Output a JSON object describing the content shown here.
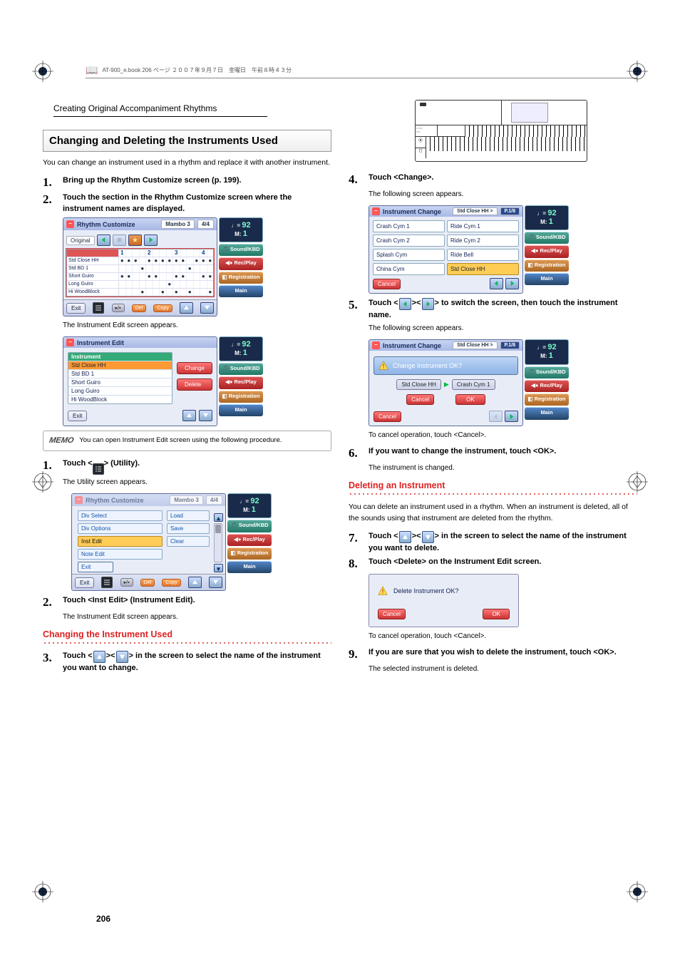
{
  "header_line": "AT-900_e.book  206 ページ  ２００７年９月７日　金曜日　午前８時４３分",
  "breadcrumb": "Creating Original Accompaniment Rhythms",
  "page_number": "206",
  "left": {
    "heading": "Changing and Deleting the Instruments Used",
    "intro": "You can change an instrument used in a rhythm and replace it with another instrument.",
    "step1": "Bring up the Rhythm Customize screen (p. 199).",
    "step2": "Touch the section in the Rhythm Customize screen where the instrument names are displayed.",
    "step2_sub": "The Instrument Edit screen appears.",
    "memo": "You can open Instrument Edit screen using the following procedure.",
    "memo_label": "MEMO",
    "m_step1_pre": "Touch <",
    "m_step1_post": "> (Utility).",
    "m_step1_sub": "The Utility screen appears.",
    "m_step2": "Touch <Inst Edit> (Instrument Edit).",
    "m_step2_sub": "The Instrument Edit screen appears.",
    "sub_heading": "Changing the Instrument Used",
    "step3_pre": "Touch <",
    "step3_mid": "><",
    "step3_post": "> in the screen to select the name of the instrument you want to change."
  },
  "right": {
    "step4": "Touch <Change>.",
    "step4_sub": "The following screen appears.",
    "step5_pre": "Touch <",
    "step5_mid": "><",
    "step5_post": "> to switch the screen, then touch the instrument name.",
    "step5_sub": "The following screen appears.",
    "step5_note": "To cancel operation, touch <Cancel>.",
    "step6": "If you want to change the instrument, touch <OK>.",
    "step6_sub": "The instrument is changed.",
    "sub_heading": "Deleting an Instrument",
    "del_intro": "You can delete an instrument used in a rhythm. When an instrument is deleted, all of the sounds using that instrument are deleted from the rhythm.",
    "step7_pre": "Touch <",
    "step7_mid": "><",
    "step7_post": "> in the screen to select the name of the instrument you want to delete.",
    "step8": "Touch <Delete> on the Instrument Edit screen.",
    "step8_note": "To cancel operation, touch <Cancel>.",
    "step9": "If you are sure that you wish to delete the instrument, touch <OK>.",
    "step9_sub": "The selected instrument is deleted."
  },
  "ui_rhythm_customize": {
    "title": "Rhythm Customize",
    "tag1": "Mambo 3",
    "tag2": "4/4",
    "tab": "Original",
    "rows": [
      "Std Close HH",
      "Std BD 1",
      "Short Guiro",
      "Long Guiro",
      "Hi WoodBlock"
    ],
    "grid": [
      [
        "●",
        "●",
        "●",
        " ",
        "●",
        "●",
        "●",
        "●",
        "●",
        "●",
        " ",
        "●",
        "●",
        "●"
      ],
      [
        " ",
        " ",
        " ",
        "●",
        " ",
        " ",
        " ",
        " ",
        " ",
        " ",
        "●",
        " ",
        " ",
        " "
      ],
      [
        "●",
        "●",
        " ",
        " ",
        "●",
        "●",
        " ",
        " ",
        "●",
        "●",
        " ",
        " ",
        "●",
        "●"
      ],
      [
        " ",
        " ",
        " ",
        " ",
        " ",
        " ",
        " ",
        "●",
        " ",
        " ",
        " ",
        " ",
        " ",
        " "
      ],
      [
        " ",
        " ",
        " ",
        "●",
        " ",
        " ",
        "●",
        " ",
        "●",
        " ",
        "●",
        " ",
        " ",
        "●"
      ]
    ],
    "grid_hdr": [
      "1",
      "",
      "",
      "",
      "2",
      "",
      "",
      "",
      "3",
      "",
      "",
      "",
      "4",
      ""
    ],
    "exit": "Exit",
    "del": "Del",
    "copy": "Copy"
  },
  "ui_inst_edit": {
    "title": "Instrument Edit",
    "hdr": "Instrument",
    "rows": [
      "Std Close HH",
      "Std BD 1",
      "Short Guiro",
      "Long Guiro",
      "Hi WoodBlock"
    ],
    "change": "Change",
    "delete": "Delete",
    "exit": "Exit"
  },
  "ui_utility": {
    "title": "Rhythm Customize",
    "tag1": "Mambo 3",
    "tag2": "4/4",
    "left": [
      "Div Select",
      "Div Options",
      "Inst Edit",
      "Note Edit",
      "Exit"
    ],
    "right": [
      "Load",
      "Save",
      "Clear"
    ],
    "exit": "Exit",
    "del": "Del",
    "copy": "Copy"
  },
  "ui_change": {
    "title": "Instrument Change",
    "tag1": "Std Close HH >",
    "tag2": "P.1/8",
    "cells": [
      "Crash Cym 1",
      "Ride Cym 1",
      "Crash Cym 2",
      "Ride Cym 2",
      "Splash Cym",
      "Ride Bell",
      "China Cym",
      "Std Close HH"
    ],
    "cancel": "Cancel"
  },
  "ui_confirm": {
    "title": "Instrument Change",
    "tag1": "Std Close HH >",
    "tag2": "P.1/8",
    "msg": "Change Instrument OK?",
    "from": "Std Close HH",
    "to": "Crash Cym 1",
    "cancel": "Cancel",
    "ok": "OK"
  },
  "ui_delete": {
    "msg": "Delete Instrument OK?",
    "cancel": "Cancel",
    "ok": "OK"
  },
  "sidebar": {
    "tempo_j": "♩=",
    "tempo_v": "92",
    "tempo_m": "M:",
    "tempo_mv": "1",
    "sound": "Sound/KBD",
    "rec": "Rec/Play",
    "reg": "Registration",
    "main": "Main"
  }
}
